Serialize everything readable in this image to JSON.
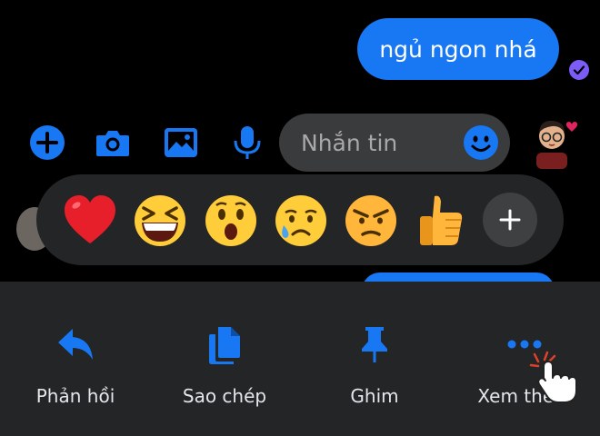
{
  "conversation": {
    "sent_message": "ngủ ngon nhá"
  },
  "composer": {
    "placeholder": "Nhắn tin",
    "icons": [
      "add-icon",
      "camera-icon",
      "image-icon",
      "microphone-icon",
      "emoji-icon"
    ]
  },
  "reactions": {
    "items": [
      "red-heart",
      "grinning-squinting-face",
      "astonished-face",
      "sad-relieved-face",
      "angry-face",
      "thumbs-up"
    ],
    "more_icon": "plus-icon"
  },
  "action_sheet": {
    "reply_label": "Phản hồi",
    "copy_label": "Sao chép",
    "pin_label": "Ghim",
    "more_label": "Xem thêm"
  },
  "colors": {
    "accent": "#1877f2",
    "background": "#000000",
    "sheet": "#242526",
    "input": "#3a3b3c",
    "seen_check": "#7b5cf5"
  }
}
